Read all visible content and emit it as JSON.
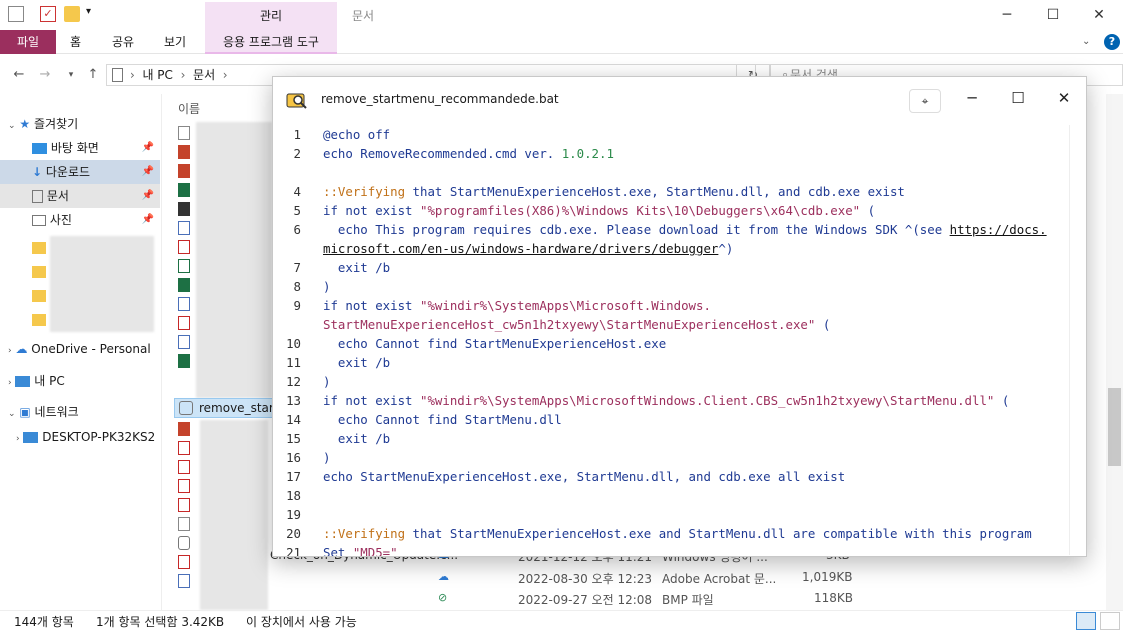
{
  "explorer": {
    "context_tab": "관리",
    "title": "문서",
    "ribbon": {
      "file": "파일",
      "tabs": [
        "홈",
        "공유",
        "보기"
      ],
      "context_sub": "응용 프로그램 도구"
    },
    "breadcrumb": [
      "내 PC",
      "문서"
    ],
    "search_placeholder": "문서 검색",
    "column_name": "이름",
    "sidebar": {
      "quick_access": "즐겨찾기",
      "items": [
        "바탕 화면",
        "다운로드",
        "문서",
        "사진"
      ],
      "onedrive": "OneDrive - Personal",
      "this_pc": "내 PC",
      "network": "네트워크",
      "desktop_machine": "DESKTOP-PK32KS2"
    },
    "selected_file": "remove_startm",
    "partial_file": "Check_on_Dynamic_Update.c...",
    "visible_rows": [
      {
        "date": "2021-12-12 오후 11:21",
        "type": "Windows 명령어 ...",
        "size": "3KB"
      },
      {
        "date": "2022-08-30 오후 12:23",
        "type": "Adobe Acrobat 문...",
        "size": "1,019KB"
      },
      {
        "date": "2022-09-27 오전 12:08",
        "type": "BMP 파일",
        "size": "118KB"
      }
    ],
    "status": {
      "count": "144개 항목",
      "selection": "1개 항목 선택함 3.42KB",
      "availability": "이 장치에서 사용 가능"
    }
  },
  "notepad": {
    "filename": "remove_startmenu_recommandede.bat"
  }
}
